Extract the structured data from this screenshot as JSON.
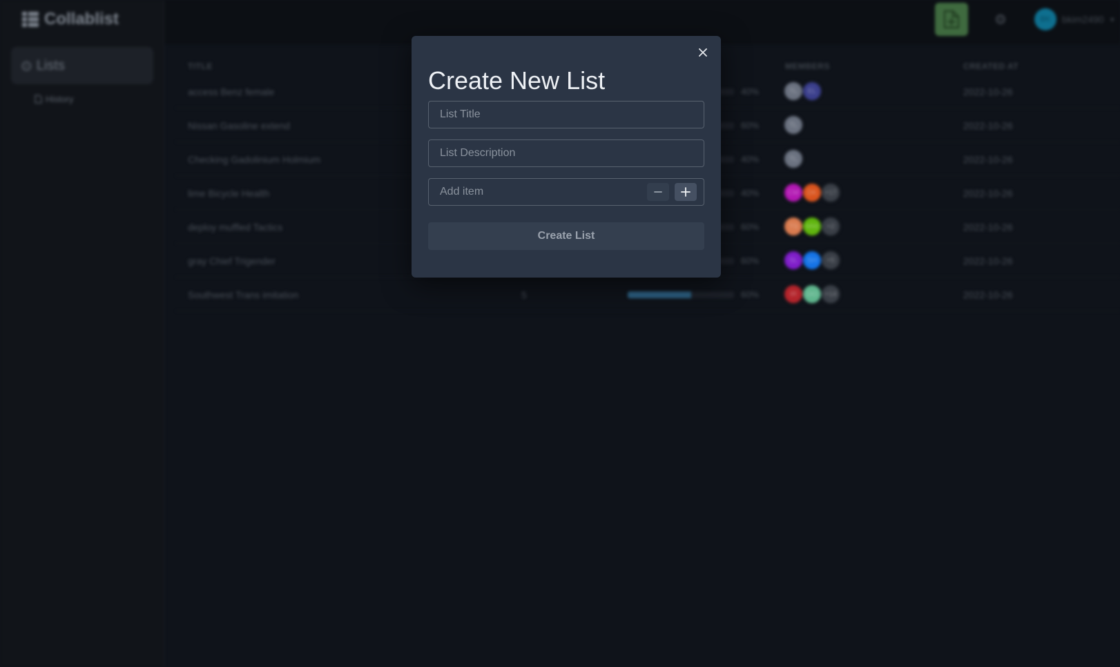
{
  "app": {
    "brand": "Collablist",
    "nav": {
      "lists": "Lists",
      "history": "History"
    },
    "user": {
      "initials": "BK",
      "name": "bkim2490"
    }
  },
  "table": {
    "headers": {
      "title": "TITLE",
      "members": "MEMBERS",
      "created_at": "CREATED AT"
    },
    "rows": [
      {
        "title": "access Benz female",
        "items": "",
        "progress_pct": 40,
        "progress_label": "40%",
        "members": [
          {
            "initials": "TL",
            "color": "#6b7280"
          },
          {
            "initials": "EL",
            "color": "#3b3f8c"
          }
        ],
        "overflow": "",
        "created": "2022-10-26"
      },
      {
        "title": "Nissan Gasoline extend",
        "items": "",
        "progress_pct": 60,
        "progress_label": "60%",
        "members": [
          {
            "initials": "TL",
            "color": "#6b7280"
          }
        ],
        "overflow": "",
        "created": "2022-10-26"
      },
      {
        "title": "Checking Gadolinium Holmium",
        "items": "",
        "progress_pct": 40,
        "progress_label": "40%",
        "members": [
          {
            "initials": "TL",
            "color": "#6b7280"
          }
        ],
        "overflow": "",
        "created": "2022-10-26"
      },
      {
        "title": "lime Bicycle Health",
        "items": "",
        "progress_pct": 40,
        "progress_label": "40%",
        "members": [
          {
            "initials": "CM",
            "color": "#b218b2"
          },
          {
            "initials": "DK",
            "color": "#d9541e"
          }
        ],
        "overflow": "+17",
        "created": "2022-10-26"
      },
      {
        "title": "deploy muffled Tactics",
        "items": "",
        "progress_pct": 60,
        "progress_label": "60%",
        "members": [
          {
            "initials": "TS",
            "color": "#d97b4f"
          },
          {
            "initials": "MW",
            "color": "#5fb50e"
          }
        ],
        "overflow": "+2",
        "created": "2022-10-26"
      },
      {
        "title": "gray Chief Trigender",
        "items": "",
        "progress_pct": 60,
        "progress_label": "60%",
        "members": [
          {
            "initials": "SL",
            "color": "#7f1ec9"
          },
          {
            "initials": "SH",
            "color": "#1573e6"
          }
        ],
        "overflow": "+5",
        "created": "2022-10-26"
      },
      {
        "title": "Southwest Trans imitation",
        "items": "5",
        "progress_pct": 60,
        "progress_label": "60%",
        "members": [
          {
            "initials": "IR",
            "color": "#b3242b"
          },
          {
            "initials": "DO",
            "color": "#5fb58d"
          }
        ],
        "overflow": "+14",
        "created": "2022-10-26"
      }
    ]
  },
  "modal": {
    "title": "Create New List",
    "list_title_placeholder": "List Title",
    "list_description_placeholder": "List Description",
    "add_item_placeholder": "Add item",
    "submit_label": "Create List"
  },
  "colors": {
    "modal_bg": "#2b3545",
    "page_bg": "#0f131a",
    "new_list_accent": "#3f6a3f",
    "progress_fill": "#2c5f80"
  }
}
